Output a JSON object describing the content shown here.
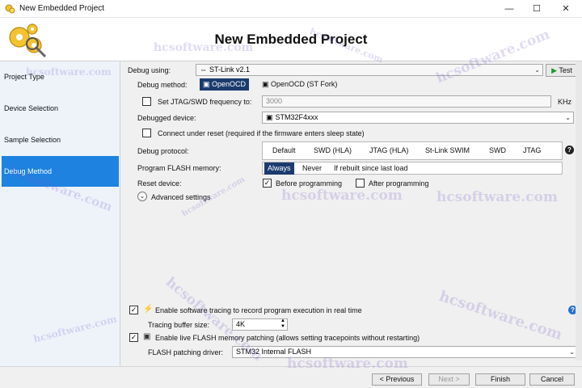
{
  "window": {
    "title": "New Embedded Project",
    "minimize_glyph": "—",
    "maximize_glyph": "☐",
    "close_glyph": "✕"
  },
  "header": {
    "page_title": "New Embedded Project"
  },
  "sidebar": {
    "items": [
      {
        "label": "Project Type"
      },
      {
        "label": "Device Selection"
      },
      {
        "label": "Sample Selection"
      },
      {
        "label": "Debug Method"
      }
    ]
  },
  "debug": {
    "using_label": "Debug using:",
    "using_value": "ST-Link v2.1",
    "test_button": "Test",
    "method_label": "Debug method:",
    "method_options": [
      "OpenOCD",
      "OpenOCD (ST Fork)"
    ],
    "jtag_freq_label": "Set JTAG/SWD frequency to:",
    "jtag_freq_value": "3000",
    "jtag_freq_unit": "KHz",
    "device_label": "Debugged device:",
    "device_value": "STM32F4xxx",
    "connect_reset_label": "Connect under reset (required if the firmware enters sleep state)",
    "protocol_label": "Debug protocol:",
    "protocol_options": [
      "Default",
      "SWD (HLA)",
      "JTAG (HLA)",
      "St-Link SWIM",
      "SWD",
      "JTAG"
    ],
    "flash_label": "Program FLASH memory:",
    "flash_options": [
      "Always",
      "Never",
      "If rebuilt since last load"
    ],
    "reset_label": "Reset device:",
    "reset_before": "Before programming",
    "reset_after": "After programming",
    "advanced_label": "Advanced settings"
  },
  "tracing": {
    "enable_label": "Enable software tracing to record program execution in real time",
    "buffer_label": "Tracing buffer size:",
    "buffer_value": "4K",
    "live_flash_label": "Enable live FLASH memory patching (allows setting tracepoints without restarting)",
    "driver_label": "FLASH patching driver:",
    "driver_value": "STM32 Internal FLASH"
  },
  "footer": {
    "previous": "< Previous",
    "next": "Next >",
    "finish": "Finish",
    "cancel": "Cancel"
  },
  "watermark": "hcsoftware.com",
  "colors": {
    "sidebar_active": "#1e82e0",
    "selected_segment": "#1b3b6e",
    "watermark": "#7a5ac8"
  }
}
